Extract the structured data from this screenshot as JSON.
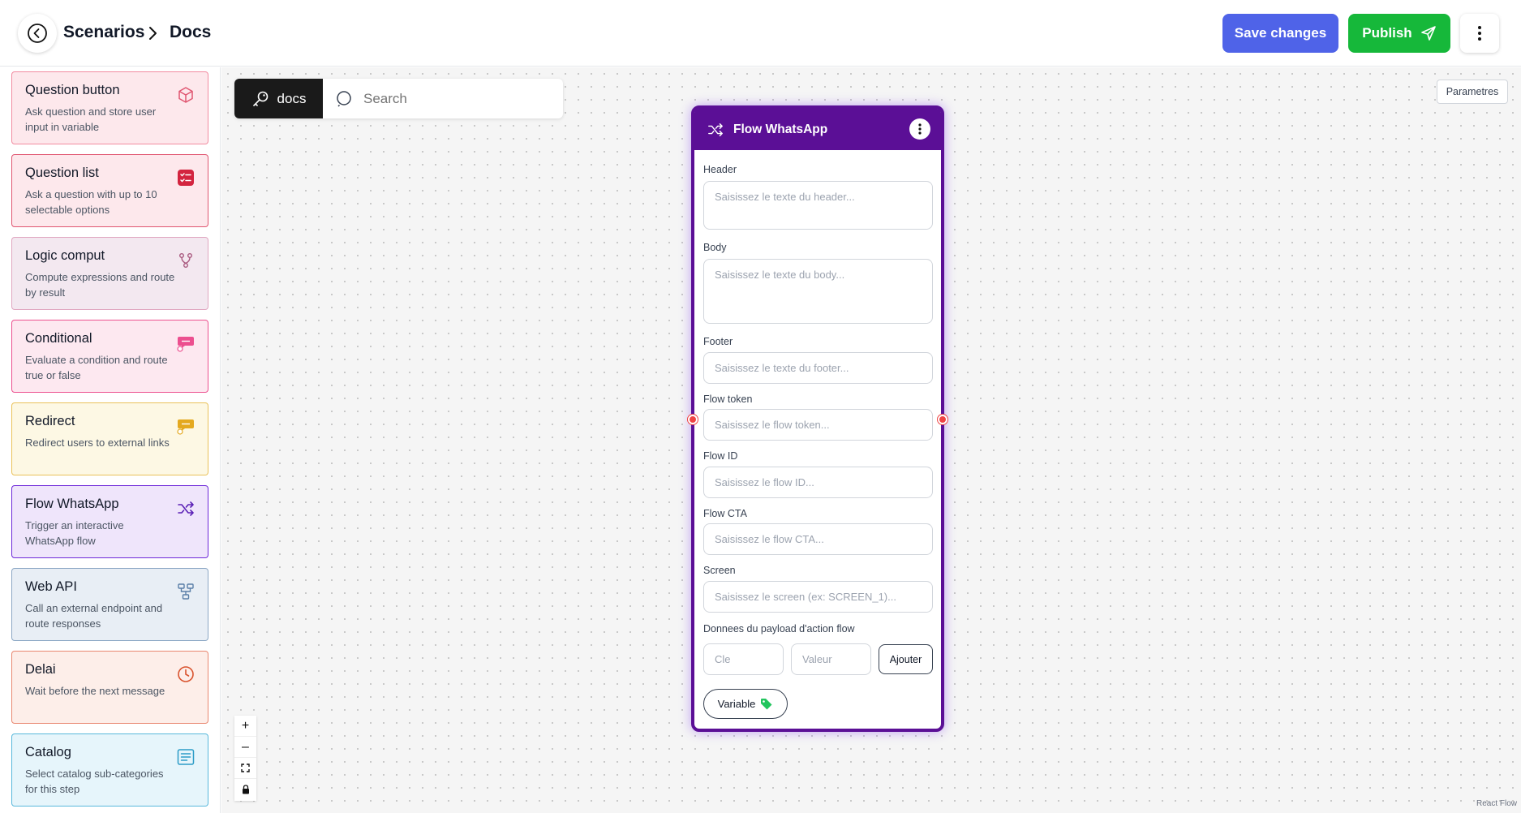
{
  "breadcrumb": {
    "items": [
      "Scenarios",
      "Docs"
    ]
  },
  "toolbar": {
    "save_label": "Save changes",
    "publish_label": "Publish"
  },
  "sidebar": {
    "items": [
      {
        "title": "Question button",
        "desc": "Ask question and store user input in variable",
        "icon": "cube-icon",
        "bg": "#fde8ec",
        "border": "#f28ba0",
        "icon_color": "#e05570"
      },
      {
        "title": "Question list",
        "desc": "Ask a question with up to 10 selectable options",
        "icon": "checklist-icon",
        "bg": "#fde8ec",
        "border": "#e05570",
        "icon_color": "#d3243f"
      },
      {
        "title": "Logic comput",
        "desc": "Compute expressions and route by result",
        "icon": "branch-icon",
        "bg": "#f3e8f0",
        "border": "#e0a6c0",
        "icon_color": "#a8587e"
      },
      {
        "title": "Conditional",
        "desc": "Evaluate a condition and route true or false",
        "icon": "chat-check-icon",
        "bg": "#fde8f0",
        "border": "#ec4f8f",
        "icon_color": "#ec4f8f"
      },
      {
        "title": "Redirect",
        "desc": "Redirect users to external links",
        "icon": "chat-icon",
        "bg": "#fdf8e4",
        "border": "#eac25a",
        "icon_color": "#e4a91f"
      },
      {
        "title": "Flow WhatsApp",
        "desc": "Trigger an interactive WhatsApp flow",
        "icon": "shuffle-icon",
        "bg": "#efe5fb",
        "border": "#6d28d9",
        "icon_color": "#5b21b6"
      },
      {
        "title": "Web API",
        "desc": "Call an external endpoint and route responses",
        "icon": "network-icon",
        "bg": "#e8eef5",
        "border": "#8ba7c4",
        "icon_color": "#5a7fa8"
      },
      {
        "title": "Delai",
        "desc": "Wait before the next message",
        "icon": "clock-icon",
        "bg": "#fdeee9",
        "border": "#e98770",
        "icon_color": "#d9532e"
      },
      {
        "title": "Catalog",
        "desc": "Select catalog sub-categories for this step",
        "icon": "list-icon",
        "bg": "#e6f5fb",
        "border": "#58b8db",
        "icon_color": "#2b9cc7"
      }
    ]
  },
  "canvas": {
    "docs_tab": "docs",
    "search_placeholder": "Search",
    "params_label": "Parametres",
    "attribution": "React Flow",
    "zoom_in": "+",
    "zoom_out": "–"
  },
  "node": {
    "title": "Flow WhatsApp",
    "fields": {
      "header": {
        "label": "Header",
        "placeholder": "Saisissez le texte du header..."
      },
      "body": {
        "label": "Body",
        "placeholder": "Saisissez le texte du body..."
      },
      "footer": {
        "label": "Footer",
        "placeholder": "Saisissez le texte du footer..."
      },
      "token": {
        "label": "Flow token",
        "placeholder": "Saisissez le flow token..."
      },
      "flow_id": {
        "label": "Flow ID",
        "placeholder": "Saisissez le flow ID..."
      },
      "cta": {
        "label": "Flow CTA",
        "placeholder": "Saisissez le flow CTA..."
      },
      "screen": {
        "label": "Screen",
        "placeholder": "Saisissez le screen (ex: SCREEN_1)..."
      }
    },
    "payload": {
      "label": "Donnees du payload d'action flow",
      "key_placeholder": "Cle",
      "value_placeholder": "Valeur",
      "add_label": "Ajouter"
    },
    "variable_label": "Variable"
  },
  "colors": {
    "accent": "#4f63e8",
    "publish": "#16b83a",
    "node": "#5b0f96"
  }
}
